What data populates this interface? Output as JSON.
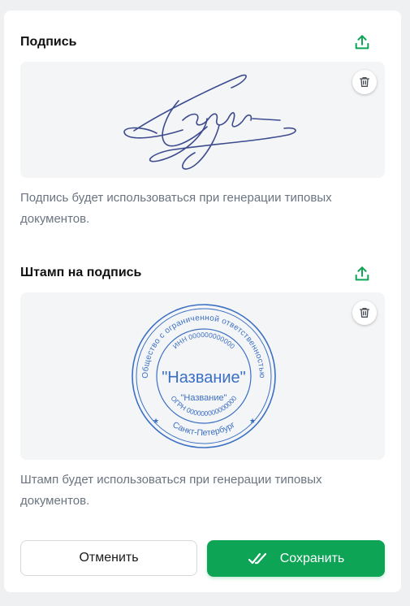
{
  "colors": {
    "accent": "#0da555",
    "stamp_blue": "#3b6fc4",
    "signature_ink": "#3d4b8f",
    "hint_text": "#6b7480"
  },
  "signature": {
    "title": "Подпись",
    "upload_icon": "upload-icon",
    "delete_icon": "trash-icon",
    "hint": "Подпись будет использоваться при генерации типовых документов."
  },
  "stamp": {
    "title": "Штамп на подпись",
    "upload_icon": "upload-icon",
    "delete_icon": "trash-icon",
    "outer_ring_text": "Общество с ограниченной ответственностью",
    "inn_text": "ИНН 000000000000",
    "name_large": "\"Название\"",
    "name_small": "\"Название\"",
    "ogrn_text": "ОГРН 000000000000000",
    "city_text": "Санкт-Петербург",
    "hint": "Штамп будет использоваться при генерации типовых документов."
  },
  "actions": {
    "cancel_label": "Отменить",
    "save_label": "Сохранить",
    "save_icon": "double-check-icon"
  }
}
